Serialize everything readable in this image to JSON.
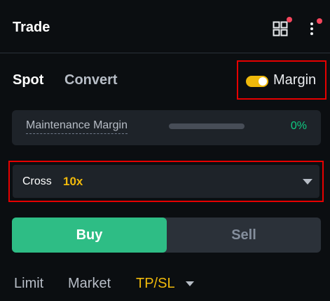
{
  "header": {
    "title": "Trade",
    "grid_icon": "grid-icon",
    "more_icon": "more-vertical-icon",
    "notification_color": "#f6465d"
  },
  "tabs": {
    "spot": "Spot",
    "convert": "Convert"
  },
  "margin_toggle": {
    "label": "Margin",
    "enabled": true,
    "color": "#f0b90b"
  },
  "maintenance": {
    "label": "Maintenance Margin",
    "value": "0%",
    "progress": 0,
    "color": "#0ecb81"
  },
  "cross": {
    "label": "Cross",
    "leverage": "10x",
    "accent": "#f0b90b"
  },
  "side": {
    "buy": "Buy",
    "sell": "Sell",
    "buy_color": "#2ebd85"
  },
  "order_types": {
    "limit": "Limit",
    "market": "Market",
    "tpsl": "TP/SL",
    "active": "TP/SL"
  }
}
